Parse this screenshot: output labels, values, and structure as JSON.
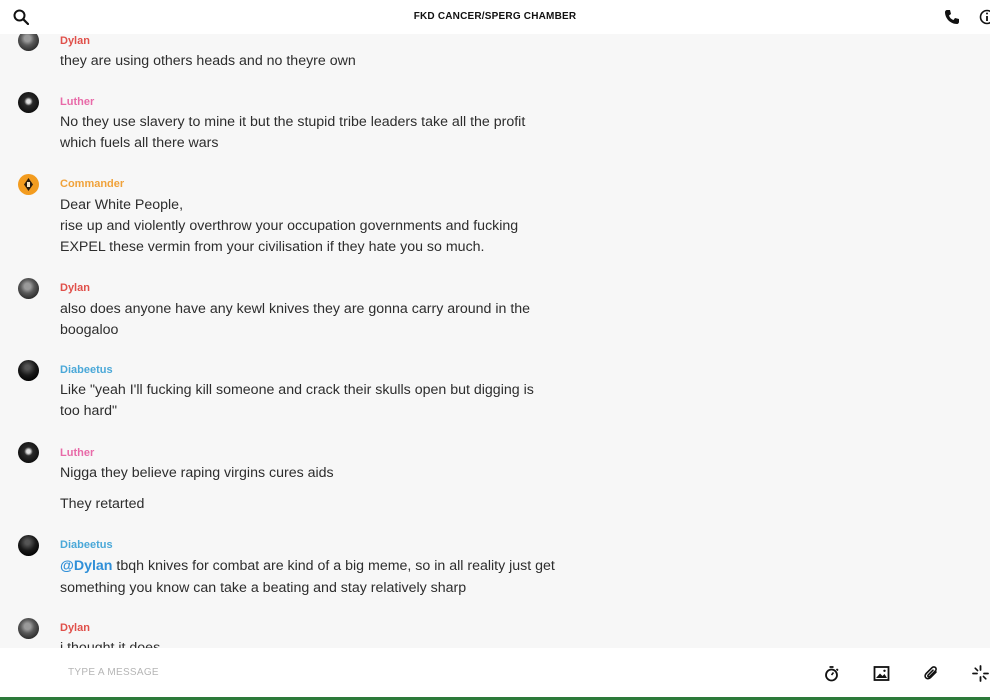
{
  "header": {
    "title": "FKD CANCER/SPERG CHAMBER"
  },
  "colors": {
    "dylan": "#e0504a",
    "luther": "#e86aa8",
    "commander": "#f0a23a",
    "diabeetus": "#4aa8d8"
  },
  "messages": [
    {
      "user": "Dylan",
      "avatar": "gray",
      "color": "#e0504a",
      "lines": [
        "they are using others heads and no theyre own"
      ]
    },
    {
      "user": "Luther",
      "avatar": "dark",
      "color": "#e86aa8",
      "lines": [
        "No they use slavery to mine it but the stupid tribe leaders take all the profit",
        "which fuels all there wars"
      ]
    },
    {
      "user": "Commander",
      "avatar": "orange",
      "color": "#f0a23a",
      "lines": [
        "Dear White People,",
        "rise up and violently overthrow your occupation governments and fucking",
        "EXPEL these vermin from your civilisation if they hate you so much."
      ]
    },
    {
      "user": "Dylan",
      "avatar": "gray",
      "color": "#e0504a",
      "lines": [
        "also does anyone have any kewl knives they are gonna carry around in the",
        "boogaloo"
      ]
    },
    {
      "user": "Diabeetus",
      "avatar": "black",
      "color": "#4aa8d8",
      "lines": [
        "Like \"yeah I'll fucking kill someone and crack their skulls open but digging is",
        "too hard\""
      ]
    },
    {
      "user": "Luther",
      "avatar": "dark",
      "color": "#e86aa8",
      "lines": [
        "Nigga they believe raping virgins cures aids",
        "They retarted"
      ]
    },
    {
      "user": "Diabeetus",
      "avatar": "black",
      "color": "#4aa8d8",
      "mention": "@Dylan",
      "lines": [
        " tbqh knives for combat are kind of a big meme, so in all reality just get",
        "something you know can take a beating and stay relatively sharp"
      ]
    },
    {
      "user": "Dylan",
      "avatar": "gray",
      "color": "#e0504a",
      "lines": [
        "i thought it does"
      ]
    }
  ],
  "composer": {
    "placeholder": "TYPE A MESSAGE",
    "icons": [
      "timer-icon",
      "image-icon",
      "paperclip-icon",
      "loading-icon"
    ]
  }
}
